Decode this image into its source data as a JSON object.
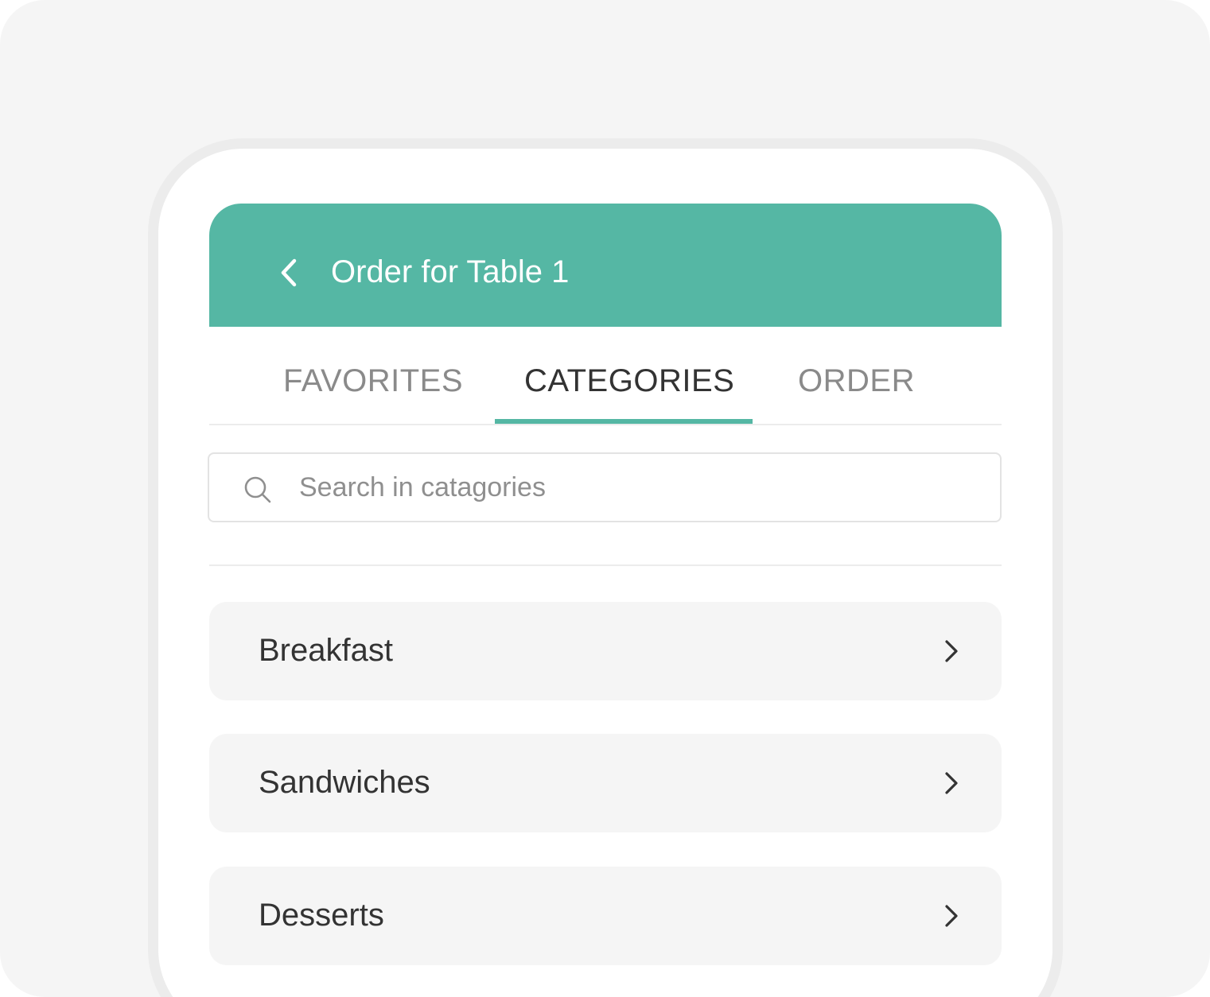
{
  "header": {
    "title": "Order for Table 1",
    "back_icon": "chevron-left-icon"
  },
  "tabs": [
    {
      "label": "FAVORITES",
      "active": false
    },
    {
      "label": "CATEGORIES",
      "active": true
    },
    {
      "label": "ORDER",
      "active": false
    }
  ],
  "search": {
    "placeholder": "Search in catagories",
    "value": "",
    "icon": "search-icon"
  },
  "categories": [
    {
      "label": "Breakfast",
      "icon": "chevron-right-icon"
    },
    {
      "label": "Sandwiches",
      "icon": "chevron-right-icon"
    },
    {
      "label": "Desserts",
      "icon": "chevron-right-icon"
    }
  ],
  "colors": {
    "accent": "#55b7a4",
    "background": "#f5f5f5",
    "text": "#333333",
    "muted_text": "#8a8a8a"
  }
}
